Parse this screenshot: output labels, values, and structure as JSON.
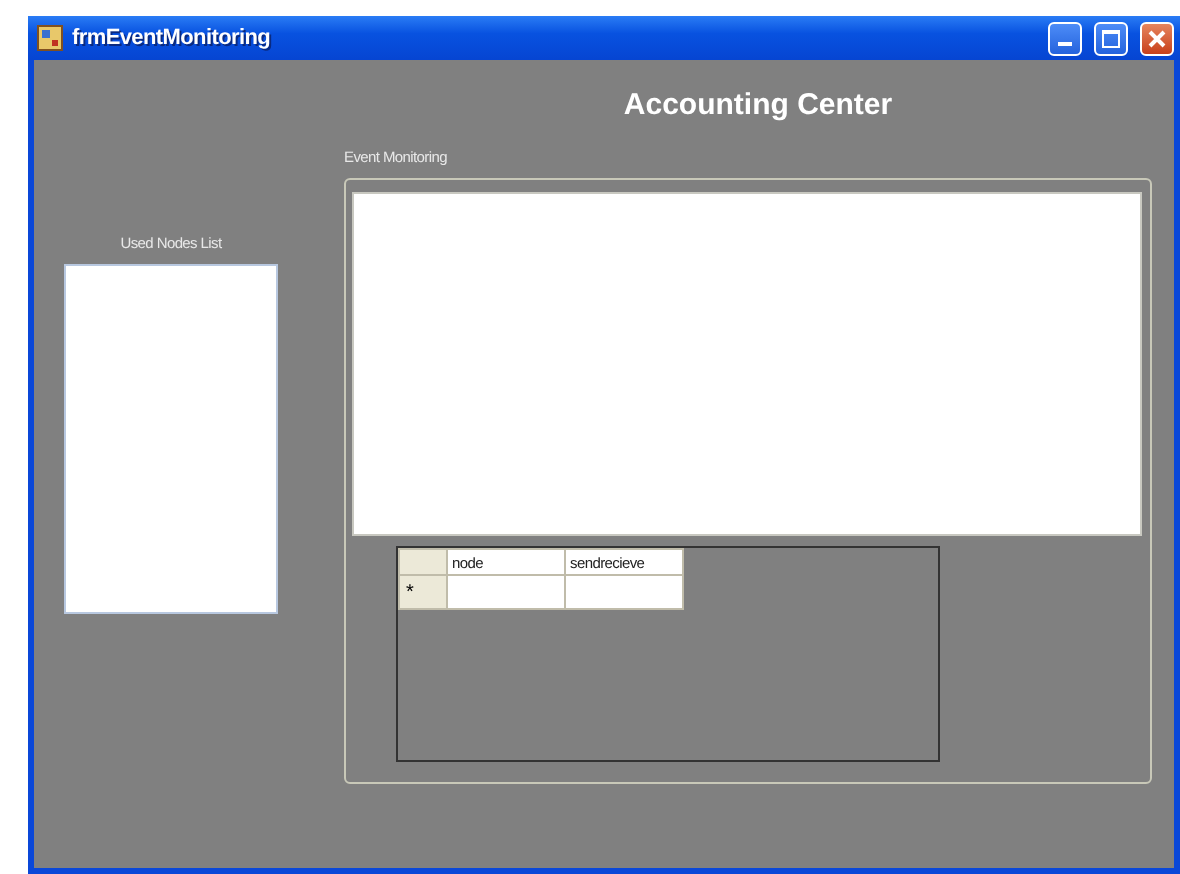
{
  "window": {
    "title": "frmEventMonitoring"
  },
  "heading": "Accounting Center",
  "nodes_panel": {
    "label": "Used Nodes List"
  },
  "event_panel": {
    "label": "Event Monitoring"
  },
  "grid": {
    "columns": [
      "node",
      "sendrecieve"
    ],
    "new_row_marker": "*"
  }
}
